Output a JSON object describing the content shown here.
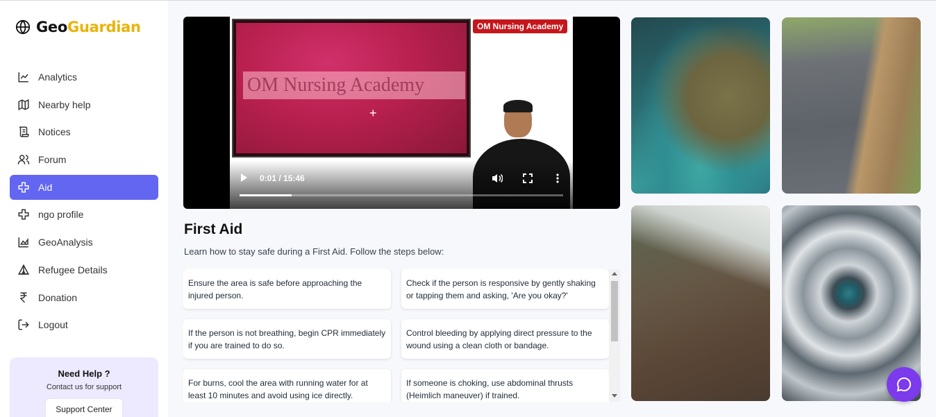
{
  "brand": {
    "part1": "Geo",
    "part2": "Guardian"
  },
  "sidebar": {
    "items": [
      {
        "label": "Analytics",
        "icon": "chart-line-icon"
      },
      {
        "label": "Nearby help",
        "icon": "map-icon"
      },
      {
        "label": "Notices",
        "icon": "scroll-icon"
      },
      {
        "label": "Forum",
        "icon": "users-icon"
      },
      {
        "label": "Aid",
        "icon": "cross-icon",
        "active": true
      },
      {
        "label": "ngo profile",
        "icon": "cross-icon"
      },
      {
        "label": "GeoAnalysis",
        "icon": "chart-area-icon"
      },
      {
        "label": "Refugee Details",
        "icon": "tent-icon"
      },
      {
        "label": "Donation",
        "icon": "rupee-icon"
      },
      {
        "label": "Logout",
        "icon": "logout-icon"
      }
    ],
    "help": {
      "title": "Need Help ?",
      "subtitle": "Contact us for support",
      "button": "Support Center"
    }
  },
  "video": {
    "channel_badge": "OM Nursing Academy",
    "board_text": "OM Nursing Academy",
    "time": "0:01 / 15:46",
    "progress": 0.16
  },
  "main": {
    "title": "First Aid",
    "description": "Learn how to stay safe during a First Aid. Follow the steps below:",
    "steps": [
      "Ensure the area is safe before approaching the injured person.",
      "Check if the person is responsive by gently shaking or tapping them and asking, 'Are you okay?'",
      "If the person is not breathing, begin CPR immediately if you are trained to do so.",
      "Control bleeding by applying direct pressure to the wound using a clean cloth or bandage.",
      "For burns, cool the area with running water for at least 10 minutes and avoid using ice directly.",
      "If someone is choking, use abdominal thrusts (Heimlich maneuver) if trained."
    ]
  },
  "colors": {
    "accent": "#6366f1",
    "brand_yellow": "#eab308",
    "chat": "#7c3aed"
  }
}
